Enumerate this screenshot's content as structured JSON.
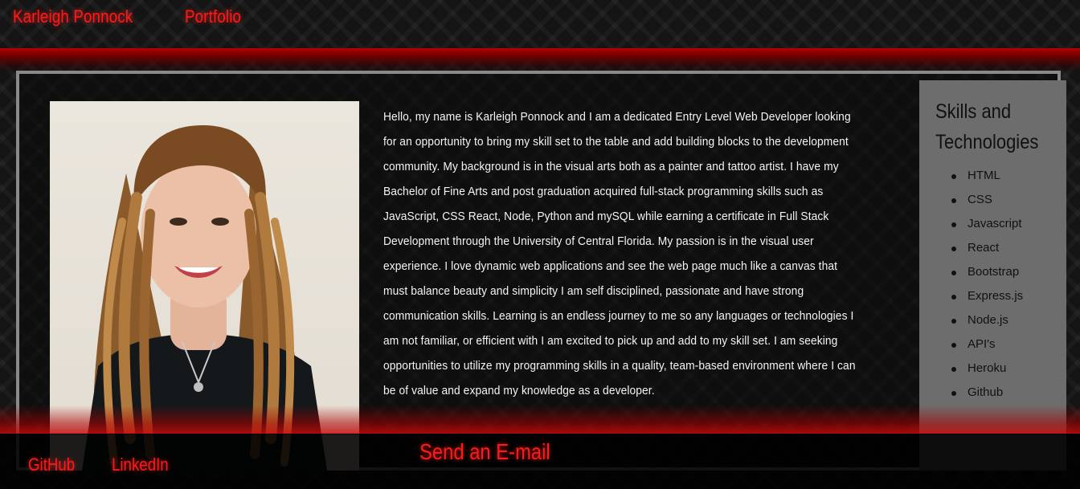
{
  "nav": {
    "name_link": "Karleigh Ponnock",
    "portfolio_link": "Portfolio"
  },
  "about": {
    "photo_alt": "Karleigh Ponnock portrait",
    "bio": "Hello, my name is Karleigh Ponnock and I am a dedicated Entry Level Web Developer looking for an opportunity to bring my skill set to the table and add building blocks to the development community. My background is in the visual arts both as a painter and tattoo artist. I have my Bachelor of Fine Arts and post graduation acquired full-stack programming skills such as JavaScript, CSS React, Node, Python and mySQL while earning a certificate in Full Stack Development through the University of Central Florida. My passion is in the visual user experience. I love dynamic web applications and see the web page much like a canvas that must balance beauty and simplicity I am self disciplined, passionate and have strong communication skills. Learning is an endless journey to me so any languages or technologies I am not familiar, or efficient with I am excited to pick up and add to my skill set. I am seeking opportunities to utilize my programming skills in a quality, team-based environment where I can be of value and expand my knowledge as a developer."
  },
  "skills": {
    "title": "Skills and Technologies",
    "items": [
      "HTML",
      "CSS",
      "Javascript",
      "React",
      "Bootstrap",
      "Express.js",
      "Node.js",
      "API's",
      "Heroku",
      "Github"
    ]
  },
  "footer": {
    "github": "GitHub",
    "linkedin": "LinkedIn",
    "email": "Send an E-mail"
  },
  "colors": {
    "accent": "#ff1a1a",
    "panel": "#6d6d6d",
    "frame": "#8a8a8a"
  }
}
